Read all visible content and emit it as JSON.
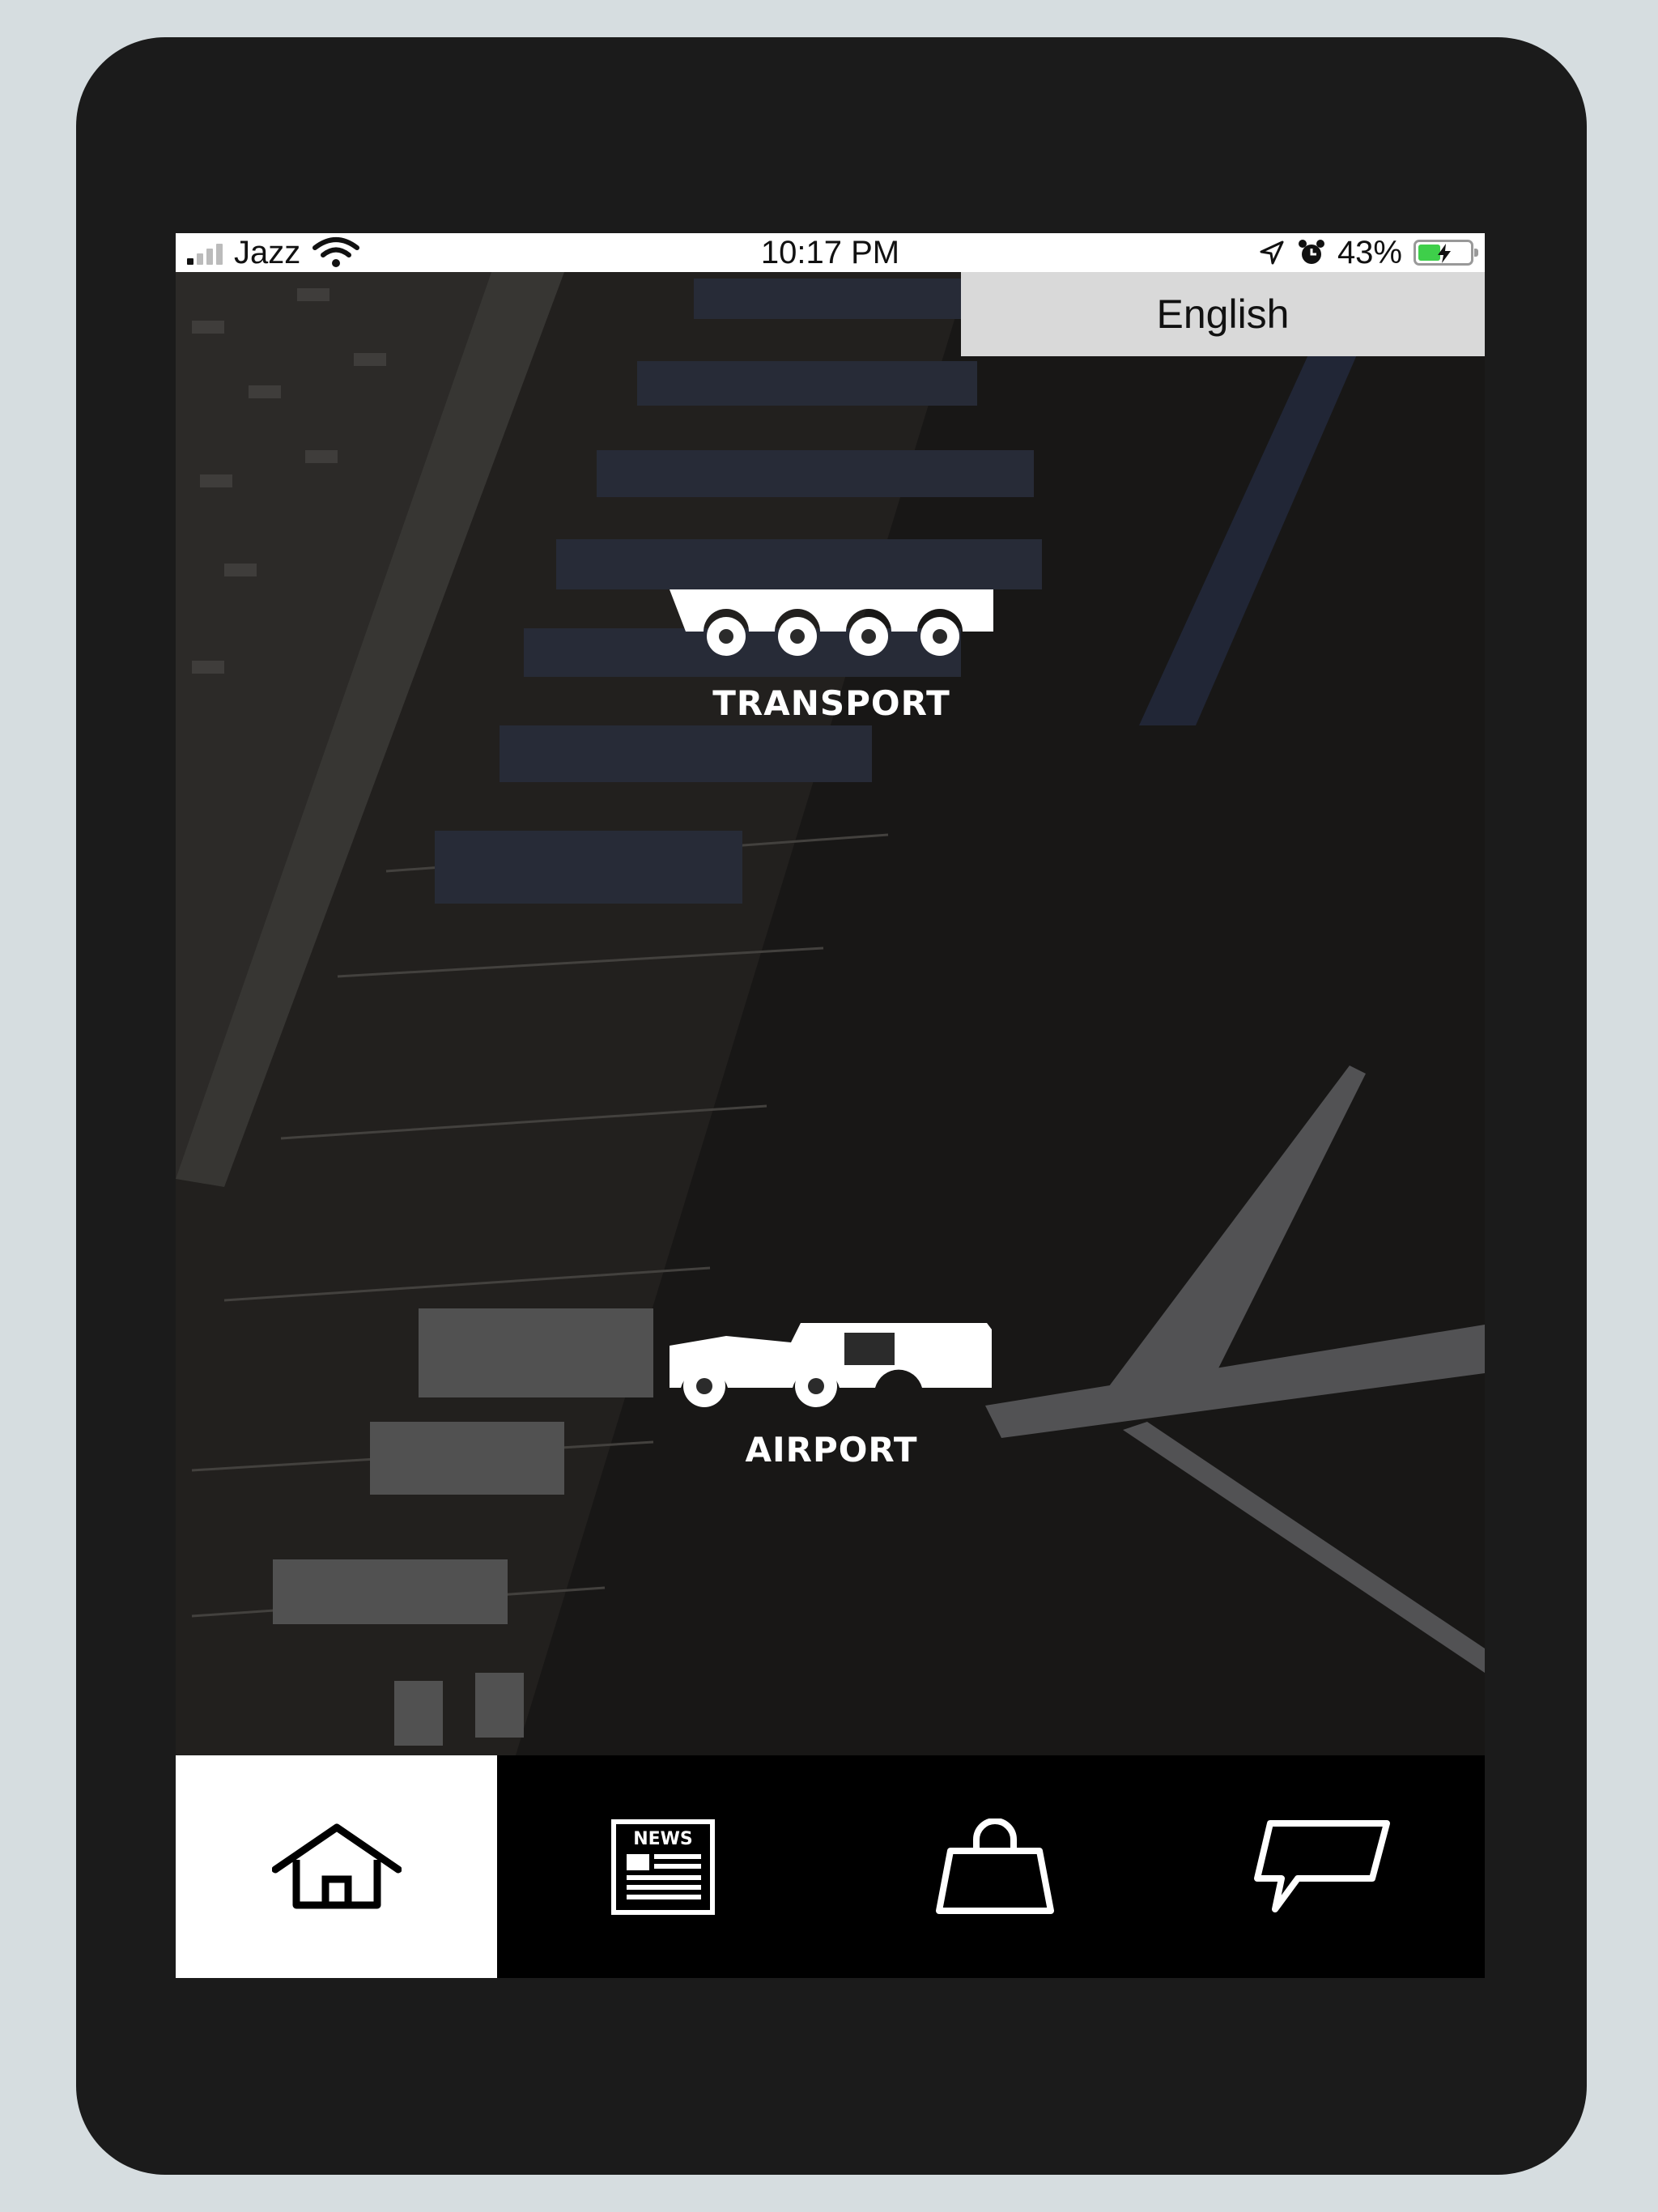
{
  "status_bar": {
    "carrier": "Jazz",
    "time": "10:17 PM",
    "battery_percent": "43%",
    "battery_level": 0.43
  },
  "language": {
    "label": "English"
  },
  "menu": {
    "transport": {
      "label": "TRANSPORT",
      "icon": "lowbed-trailer-icon"
    },
    "airport": {
      "label": "AIRPORT",
      "icon": "aircraft-tug-icon"
    }
  },
  "tab_bar": {
    "active_index": 0,
    "tabs": [
      {
        "icon": "home-icon"
      },
      {
        "icon": "news-icon",
        "badge_text": "NEWS"
      },
      {
        "icon": "shopping-bag-icon"
      },
      {
        "icon": "chat-icon"
      }
    ]
  },
  "colors": {
    "device": "#1b1b1b",
    "page_background": "#d6dde0",
    "tab_bar": "#000000",
    "tab_active": "#ffffff",
    "language_bar": "#d9d9d9",
    "battery_fill": "#3ecf4a"
  }
}
